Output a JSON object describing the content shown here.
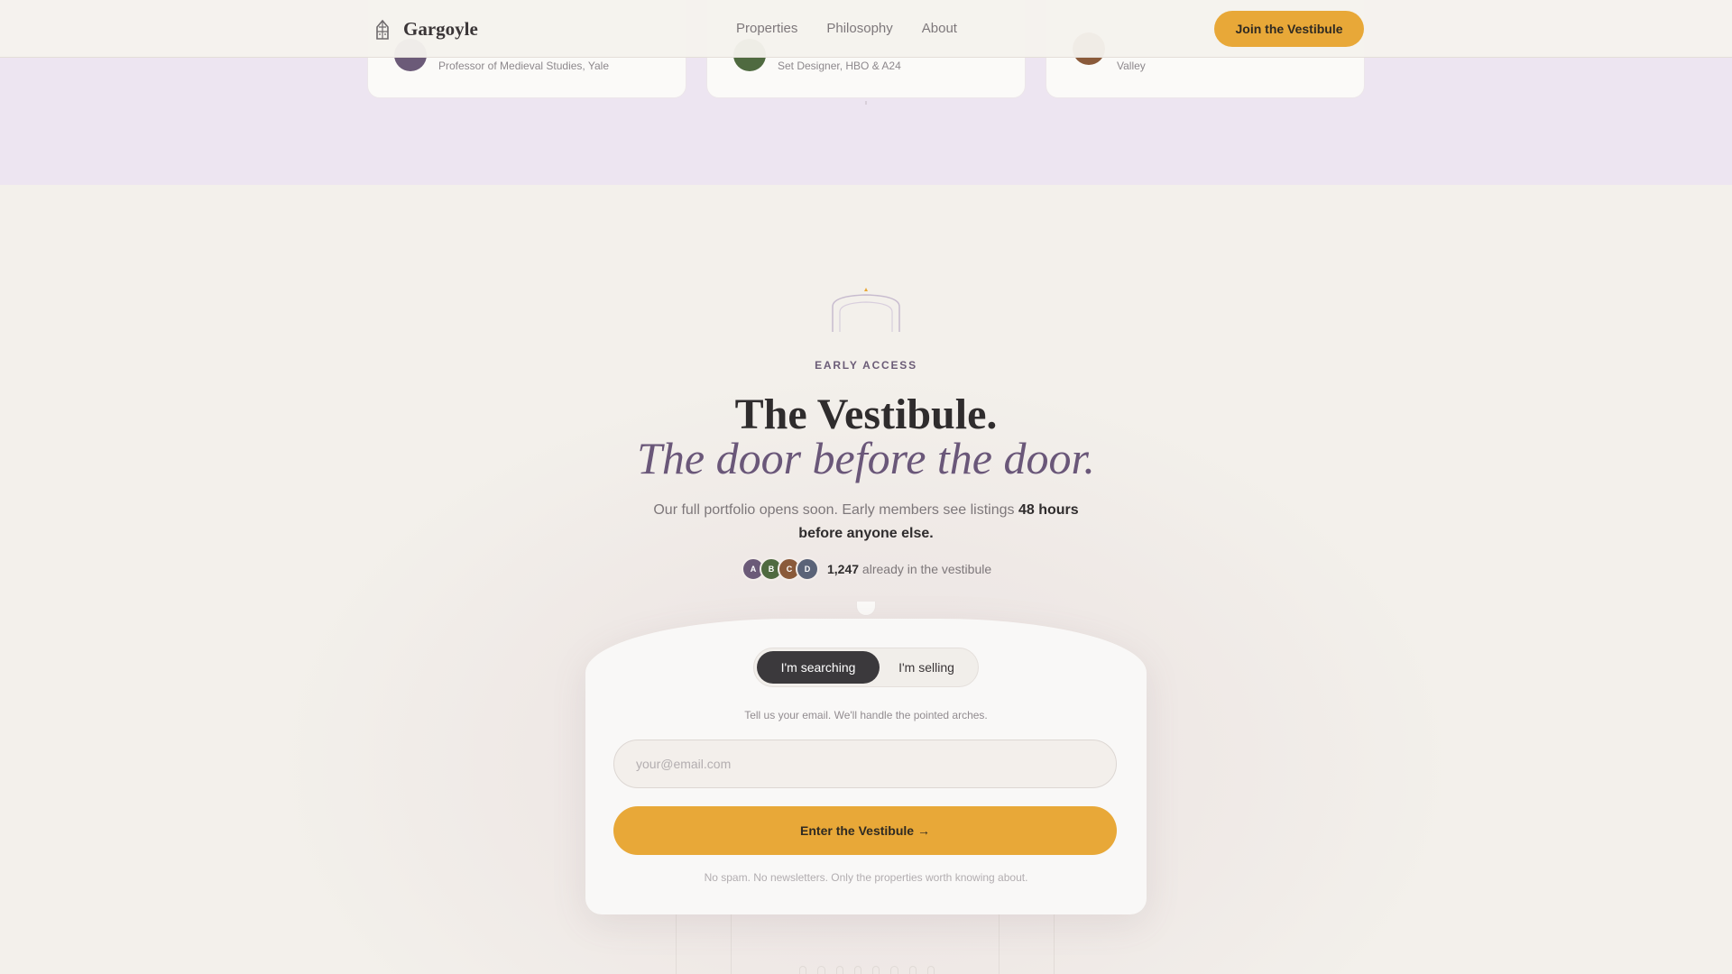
{
  "brand": {
    "name": "Gargoyle",
    "accent_color": "#e8a838",
    "purple_color": "#6a5779"
  },
  "nav": {
    "items": [
      {
        "label": "Properties"
      },
      {
        "label": "Philosophy"
      },
      {
        "label": "About"
      }
    ],
    "cta_label": "Join the Vestibule"
  },
  "testimonials": [
    {
      "role": "Professor of Medieval Studies, Yale",
      "avatar_color": "#6b5a78"
    },
    {
      "role": "Set Designer, HBO & A24",
      "avatar_color": "#4f6a40"
    },
    {
      "role": "Valley",
      "avatar_color": "#8a5a3a"
    }
  ],
  "hero": {
    "eyebrow": "EARLY ACCESS",
    "title": "The Vestibule.",
    "subtitle": "The door before the door.",
    "desc_prefix": "Our full portfolio opens soon. Early members see listings ",
    "desc_bold": "48 hours before anyone else.",
    "social_avatars": [
      {
        "initial": "A",
        "color": "#6b5a78"
      },
      {
        "initial": "B",
        "color": "#4f6a40"
      },
      {
        "initial": "C",
        "color": "#8a5a3a"
      },
      {
        "initial": "D",
        "color": "#5a6378"
      }
    ],
    "member_count": "1,247",
    "member_suffix": " already in the vestibule"
  },
  "form": {
    "toggle_active": "I'm searching",
    "toggle_inactive": "I'm selling",
    "hint": "Tell us your email. We'll handle the pointed arches.",
    "email_value": "",
    "email_placeholder": "your@email.com",
    "submit_label": "Enter the Vestibule →",
    "fine_print": "No spam. No newsletters. Only the properties worth knowing about."
  }
}
